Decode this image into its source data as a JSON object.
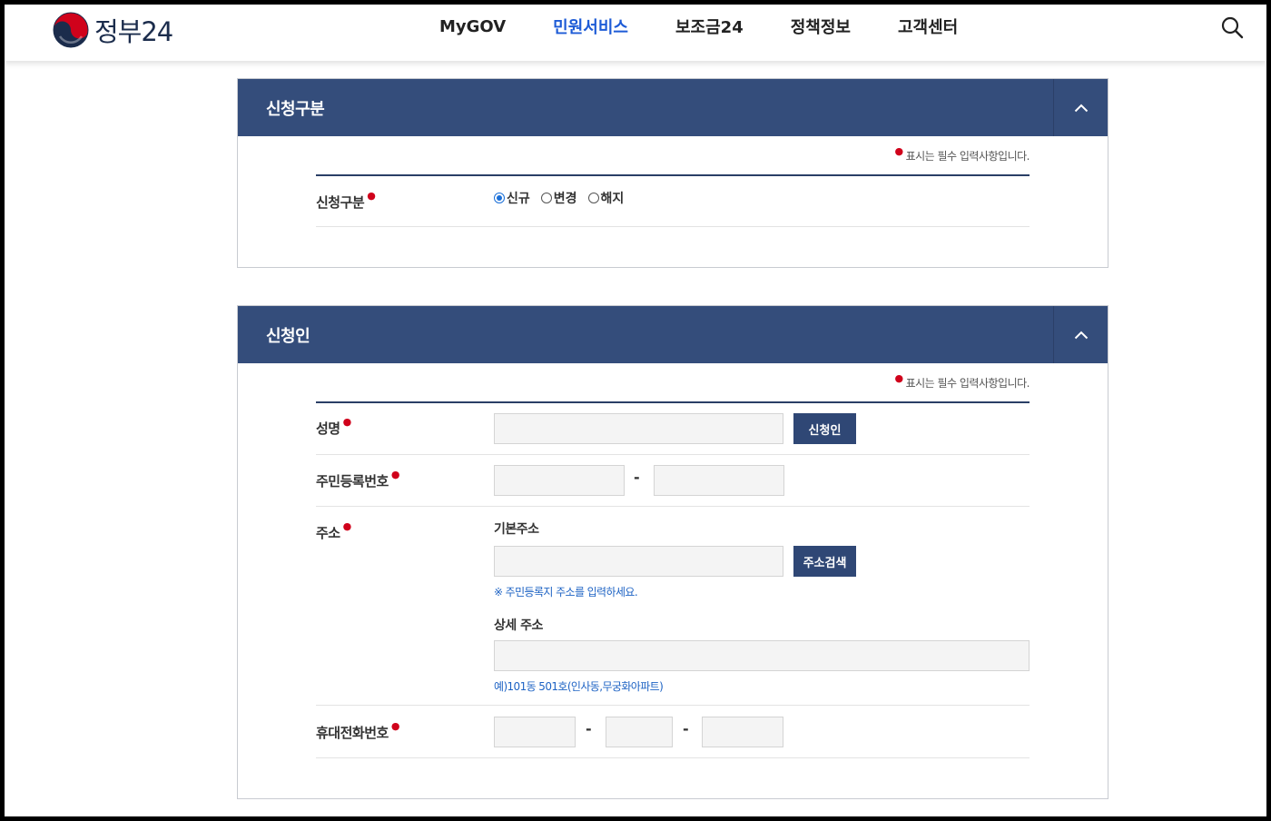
{
  "header": {
    "logo_text": "정부24",
    "nav": [
      {
        "label": "MyGOV",
        "active": false
      },
      {
        "label": "민원서비스",
        "active": true
      },
      {
        "label": "보조금24",
        "active": false
      },
      {
        "label": "정책정보",
        "active": false
      },
      {
        "label": "고객센터",
        "active": false
      }
    ],
    "search_icon": "search-icon"
  },
  "section1": {
    "title": "신청구분",
    "required_note": "표시는 필수 입력사항입니다.",
    "fields": {
      "type": {
        "label": "신청구분",
        "options": [
          "신규",
          "변경",
          "해지"
        ],
        "selected": "신규"
      }
    }
  },
  "section2": {
    "title": "신청인",
    "required_note": "표시는 필수 입력사항입니다.",
    "name": {
      "label": "성명",
      "value": "",
      "button": "신청인"
    },
    "rrn": {
      "label": "주민등록번호",
      "part1": "",
      "part2": "",
      "separator": "-"
    },
    "address": {
      "label": "주소",
      "basic_label": "기본주소",
      "basic_value": "",
      "search_button": "주소검색",
      "basic_hint": "※ 주민등록지 주소를 입력하세요.",
      "detail_label": "상세 주소",
      "detail_value": "",
      "detail_hint": "예)101동 501호(인사동,무궁화아파트)"
    },
    "phone": {
      "label": "휴대전화번호",
      "part1": "",
      "part2": "",
      "part3": "",
      "separator": "-"
    }
  },
  "colors": {
    "section_header": "#344d7b",
    "button": "#2f4775",
    "active_nav": "#1d5bd6",
    "required": "#d0021b",
    "hint": "#1e63c4"
  }
}
